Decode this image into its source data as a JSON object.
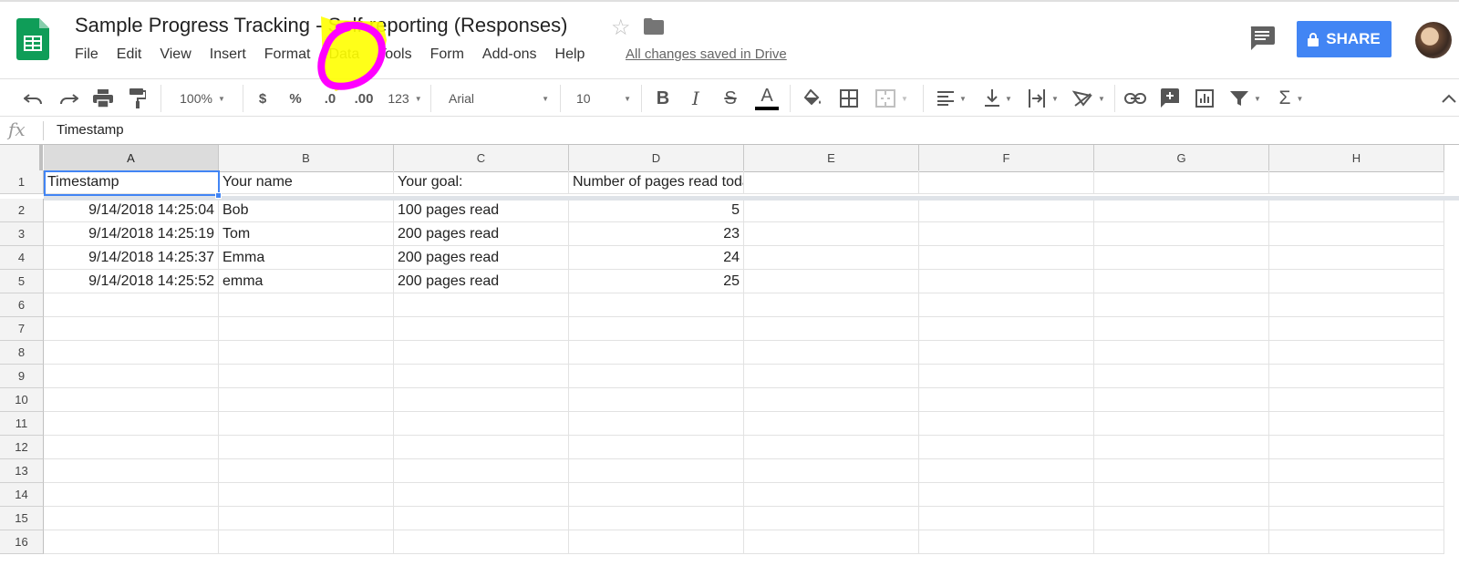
{
  "doc": {
    "title": "Sample Progress Tracking - Self-reporting (Responses)",
    "save_status": "All changes saved in Drive"
  },
  "menu": [
    "File",
    "Edit",
    "View",
    "Insert",
    "Format",
    "Data",
    "Tools",
    "Form",
    "Add-ons",
    "Help"
  ],
  "share": {
    "label": "SHARE"
  },
  "toolbar": {
    "zoom": "100%",
    "currency": "$",
    "percent": "%",
    "decrease_decimal": ".0",
    "increase_decimal": ".00",
    "more_formats": "123",
    "font": "Arial",
    "font_size": "10",
    "bold": "B",
    "italic": "I",
    "strike": "S",
    "text_color": "A",
    "sum": "Σ"
  },
  "formula_bar": {
    "fx": "fx",
    "value": "Timestamp"
  },
  "sheet": {
    "columns": [
      "A",
      "B",
      "C",
      "D",
      "E",
      "F",
      "G",
      "H"
    ],
    "rows": [
      "1",
      "2",
      "3",
      "4",
      "5",
      "6",
      "7",
      "8",
      "9",
      "10",
      "11",
      "12",
      "13",
      "14",
      "15",
      "16"
    ],
    "header": [
      "Timestamp",
      "Your name",
      "Your goal:",
      "Number of pages read today"
    ],
    "data": [
      [
        "9/14/2018 14:25:04",
        "Bob",
        "100 pages read",
        "5"
      ],
      [
        "9/14/2018 14:25:19",
        "Tom",
        "200 pages read",
        "23"
      ],
      [
        "9/14/2018 14:25:37",
        "Emma",
        "200 pages read",
        "24"
      ],
      [
        "9/14/2018 14:25:52",
        "emma",
        "200 pages read",
        "25"
      ]
    ],
    "selected_cell": "A1"
  },
  "colors": {
    "accent": "#4285f4",
    "sheets_green": "#0f9d58",
    "annotation_magenta": "#ff00ff",
    "annotation_yellow": "#ffff00"
  },
  "icons": [
    "sheets-logo-icon",
    "star-icon",
    "folder-icon",
    "comments-icon",
    "lock-icon",
    "undo-icon",
    "redo-icon",
    "print-icon",
    "paint-format-icon",
    "fill-color-icon",
    "borders-icon",
    "merge-cells-icon",
    "align-left-icon",
    "vertical-align-icon",
    "text-wrap-icon",
    "text-rotate-icon",
    "link-icon",
    "insert-comment-icon",
    "insert-chart-icon",
    "filter-icon",
    "functions-icon",
    "collapse-icon"
  ]
}
